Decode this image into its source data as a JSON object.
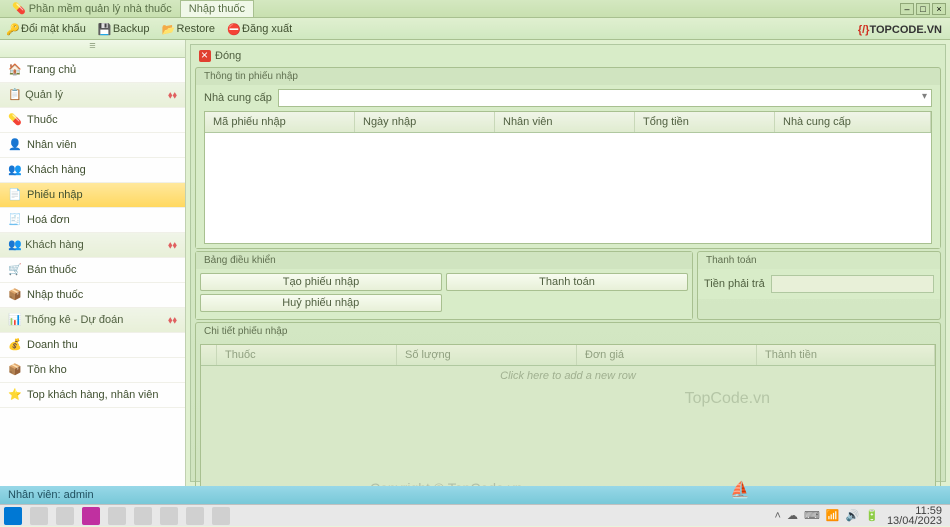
{
  "titlebar": {
    "tab_main": "Phần mềm quản lý nhà thuốc",
    "tab_active": "Nhập thuốc"
  },
  "toolbar": {
    "change_pass": "Đổi mật khẩu",
    "backup": "Backup",
    "restore": "Restore",
    "logout": "Đăng xuất"
  },
  "logo": {
    "text": "TOPCODE.VN"
  },
  "sidebar": {
    "home": "Trang chủ",
    "manage": "Quản lý",
    "items": {
      "thuoc": "Thuốc",
      "nhanvien": "Nhân viên",
      "khachhang": "Khách hàng",
      "phieunhap": "Phiếu nhập",
      "hoadon": "Hoá đơn"
    },
    "customer": "Khách hàng",
    "customer_items": {
      "banthuoc": "Bán thuốc",
      "nhapthuoc": "Nhập thuốc"
    },
    "stats": "Thống kê - Dự đoán",
    "stats_items": {
      "doanhthu": "Doanh thu",
      "tonkho": "Tồn kho",
      "top": "Top khách hàng, nhân viên"
    }
  },
  "content": {
    "close": "Đóng",
    "panel1_title": "Thông tin phiếu nhập",
    "supplier_label": "Nhà cung cấp",
    "grid_cols": {
      "c1": "Mã phiếu nhập",
      "c2": "Ngày nhập",
      "c3": "Nhân viên",
      "c4": "Tổng tiền",
      "c5": "Nhà cung cấp"
    },
    "control_title": "Bảng điều khiển",
    "btn_create": "Tạo phiếu nhập",
    "btn_pay": "Thanh toán",
    "btn_cancel": "Huỷ phiếu nhập",
    "payment_title": "Thanh toán",
    "amount_label": "Tiền phải trả",
    "detail_title": "Chi tiết phiếu nhập",
    "detail_cols": {
      "c1": "Thuốc",
      "c2": "Số lượng",
      "c3": "Đơn giá",
      "c4": "Thành tiền"
    },
    "detail_placeholder": "Click here to add a new row"
  },
  "watermarks": {
    "w1": "TopCode.vn",
    "w2": "Copyright © TopCode.vn"
  },
  "statusbar": {
    "user": "Nhân viên: admin"
  },
  "taskbar": {
    "time": "11:59",
    "date": "13/04/2023"
  }
}
